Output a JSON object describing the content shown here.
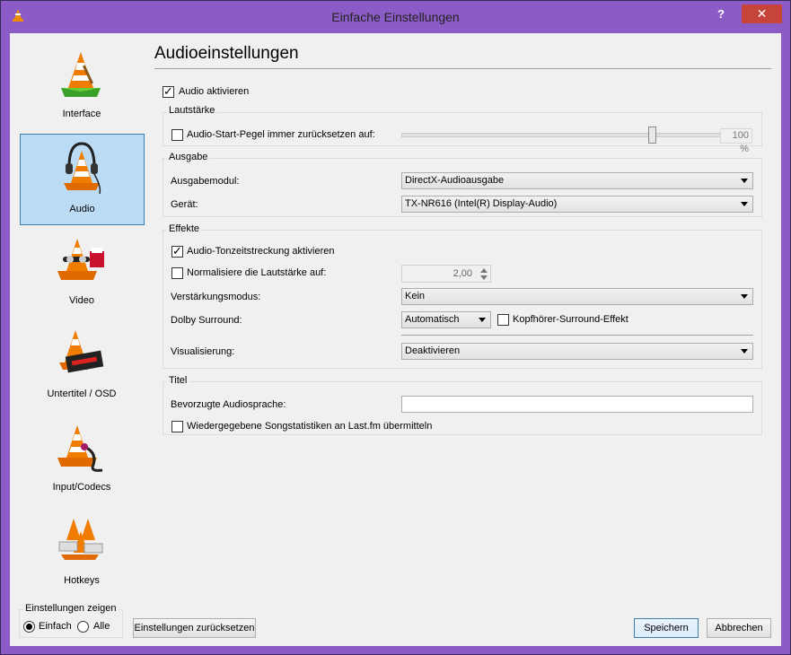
{
  "window": {
    "title": "Einfache Einstellungen",
    "help_label": "?",
    "close_label": "✕"
  },
  "sidebar": {
    "items": [
      {
        "label": "Interface",
        "icon": "vlc-cone-interface-icon"
      },
      {
        "label": "Audio",
        "icon": "vlc-cone-headphones-icon",
        "selected": true
      },
      {
        "label": "Video",
        "icon": "vlc-cone-video-icon"
      },
      {
        "label": "Untertitel / OSD",
        "icon": "vlc-cone-subtitles-icon"
      },
      {
        "label": "Input/Codecs",
        "icon": "vlc-cone-codecs-icon"
      },
      {
        "label": "Hotkeys",
        "icon": "vlc-cone-hotkeys-icon"
      }
    ]
  },
  "main": {
    "heading": "Audioeinstellungen",
    "enable_audio": {
      "label": "Audio aktivieren",
      "checked": true
    },
    "volume": {
      "title": "Lautstärke",
      "reset_label": "Audio-Start-Pegel immer zurücksetzen auf:",
      "reset_checked": false,
      "level": "100 %"
    },
    "output": {
      "title": "Ausgabe",
      "module_label": "Ausgabemodul:",
      "module_value": "DirectX-Audioausgabe",
      "device_label": "Gerät:",
      "device_value": "TX-NR616 (Intel(R) Display-Audio)"
    },
    "effects": {
      "title": "Effekte",
      "timestretch_label": "Audio-Tonzeitstreckung aktivieren",
      "timestretch_checked": true,
      "normalize_label": "Normalisiere die Lautstärke auf:",
      "normalize_checked": false,
      "normalize_value": "2,00",
      "gain_label": "Verstärkungsmodus:",
      "gain_value": "Kein",
      "dolby_label": "Dolby Surround:",
      "dolby_value": "Automatisch",
      "headphone_label": "Kopfhörer-Surround-Effekt",
      "headphone_checked": false,
      "visual_label": "Visualisierung:",
      "visual_value": "Deaktivieren"
    },
    "tracks": {
      "title": "Titel",
      "language_label": "Bevorzugte Audiosprache:",
      "language_value": "",
      "lastfm_label": "Wiedergegebene Songstatistiken an Last.fm übermitteln",
      "lastfm_checked": false
    }
  },
  "footer": {
    "show_settings_title": "Einstellungen zeigen",
    "simple_label": "Einfach",
    "all_label": "Alle",
    "reset_button": "Einstellungen zurücksetzen",
    "save_button": "Speichern",
    "cancel_button": "Abbrechen"
  }
}
